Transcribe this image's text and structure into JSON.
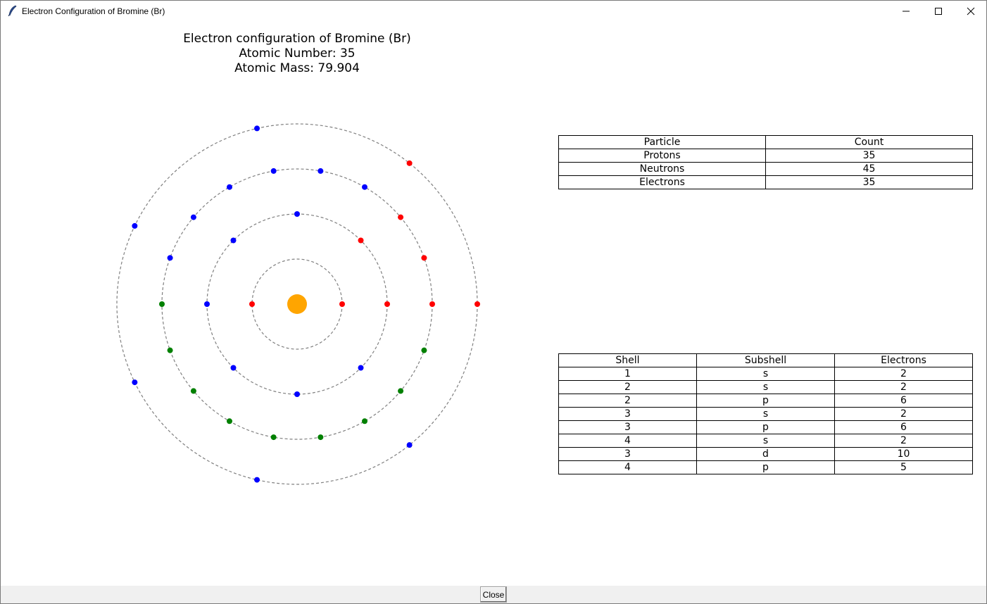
{
  "window": {
    "title": "Electron Configuration of Bromine (Br)"
  },
  "plot": {
    "title_lines": [
      "Electron configuration of Bromine (Br)",
      "Atomic Number: 35",
      "Atomic Mass: 79.904"
    ],
    "nucleus_color": "#ffa500",
    "orbit_color": "#808080",
    "electron_colors": {
      "red": "#ff0000",
      "blue": "#0000ff",
      "green": "#008000"
    },
    "shells": [
      {
        "electrons": [
          "red",
          "red"
        ]
      },
      {
        "electrons": [
          "red",
          "red",
          "blue",
          "blue",
          "blue",
          "blue",
          "blue",
          "blue"
        ]
      },
      {
        "electrons": [
          "red",
          "red",
          "red",
          "blue",
          "blue",
          "blue",
          "blue",
          "blue",
          "blue",
          "green",
          "green",
          "green",
          "green",
          "green",
          "green",
          "green",
          "green",
          "green"
        ]
      },
      {
        "electrons": [
          "red",
          "red",
          "blue",
          "blue",
          "blue",
          "blue",
          "blue"
        ]
      }
    ]
  },
  "particle_table": {
    "headers": [
      "Particle",
      "Count"
    ],
    "rows": [
      [
        "Protons",
        "35"
      ],
      [
        "Neutrons",
        "45"
      ],
      [
        "Electrons",
        "35"
      ]
    ]
  },
  "config_table": {
    "headers": [
      "Shell",
      "Subshell",
      "Electrons"
    ],
    "rows": [
      [
        "1",
        "s",
        "2"
      ],
      [
        "2",
        "s",
        "2"
      ],
      [
        "2",
        "p",
        "6"
      ],
      [
        "3",
        "s",
        "2"
      ],
      [
        "3",
        "p",
        "6"
      ],
      [
        "4",
        "s",
        "2"
      ],
      [
        "3",
        "d",
        "10"
      ],
      [
        "4",
        "p",
        "5"
      ]
    ]
  },
  "footer": {
    "close_label": "Close"
  }
}
